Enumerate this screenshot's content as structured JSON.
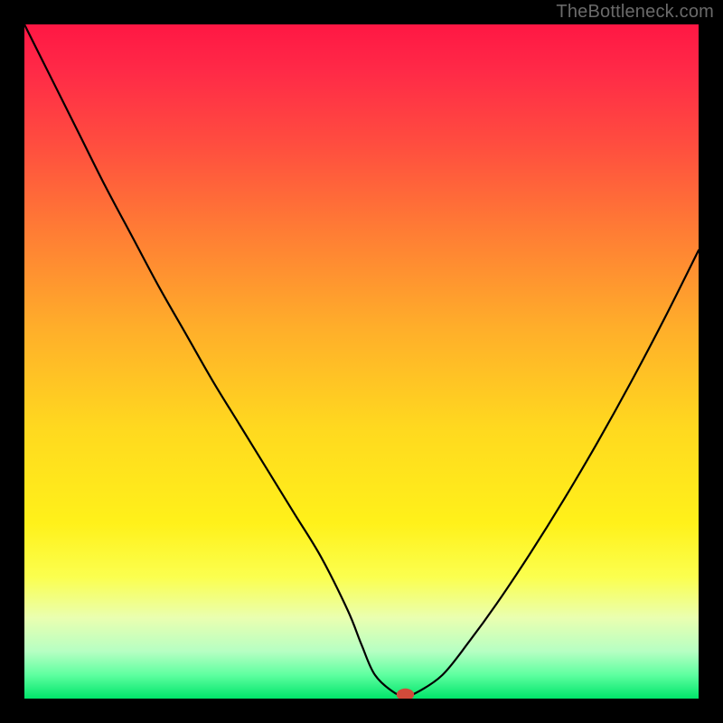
{
  "watermark": "TheBottleneck.com",
  "chart_data": {
    "type": "line",
    "title": "",
    "xlabel": "",
    "ylabel": "",
    "xlim": [
      0,
      100
    ],
    "ylim": [
      0,
      100
    ],
    "grid": false,
    "legend": false,
    "axes_visible": false,
    "background_gradient": {
      "stops": [
        {
          "offset": 0.0,
          "color": "#ff1744"
        },
        {
          "offset": 0.07,
          "color": "#ff2a47"
        },
        {
          "offset": 0.18,
          "color": "#ff4e3f"
        },
        {
          "offset": 0.3,
          "color": "#ff7a35"
        },
        {
          "offset": 0.45,
          "color": "#ffae2a"
        },
        {
          "offset": 0.6,
          "color": "#ffd91f"
        },
        {
          "offset": 0.74,
          "color": "#fff11a"
        },
        {
          "offset": 0.82,
          "color": "#fbff4f"
        },
        {
          "offset": 0.88,
          "color": "#eaffb0"
        },
        {
          "offset": 0.93,
          "color": "#b6ffc3"
        },
        {
          "offset": 0.965,
          "color": "#5effa0"
        },
        {
          "offset": 1.0,
          "color": "#00e56a"
        }
      ]
    },
    "series": [
      {
        "name": "bottleneck-curve",
        "stroke": "#000000",
        "stroke_width": 2.2,
        "x": [
          0.0,
          4.0,
          8.0,
          12.0,
          16.0,
          20.0,
          24.0,
          28.0,
          32.0,
          36.0,
          40.0,
          44.0,
          48.0,
          50.0,
          52.0,
          55.0,
          56.5,
          58.0,
          62.0,
          66.0,
          70.0,
          75.0,
          80.0,
          85.0,
          90.0,
          95.0,
          100.0
        ],
        "y": [
          100.0,
          92.0,
          84.0,
          76.0,
          68.5,
          61.0,
          54.0,
          47.0,
          40.5,
          34.0,
          27.5,
          21.0,
          13.0,
          8.0,
          3.5,
          0.8,
          0.6,
          0.8,
          3.5,
          8.5,
          14.0,
          21.5,
          29.5,
          38.0,
          47.0,
          56.5,
          66.5
        ]
      }
    ],
    "marker": {
      "name": "optimal-point",
      "x": 56.5,
      "y": 0.6,
      "rx": 1.3,
      "ry": 0.9,
      "fill": "#d24a3a"
    }
  }
}
